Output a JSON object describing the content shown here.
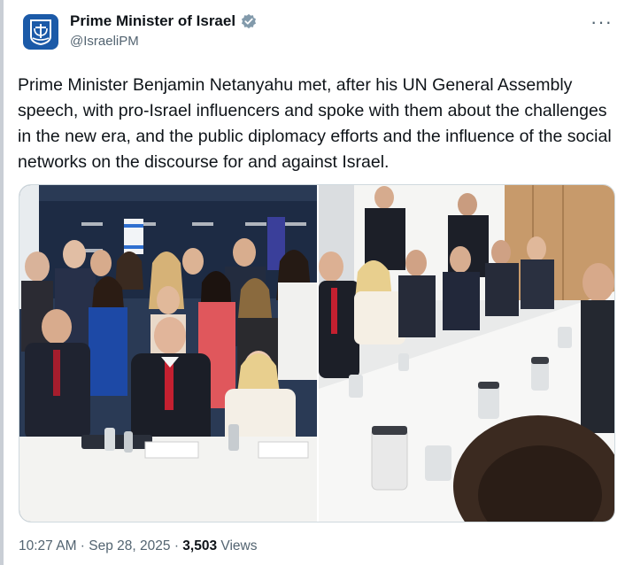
{
  "post": {
    "display_name": "Prime Minister of Israel",
    "handle": "@IsraeliPM",
    "more_label": "···",
    "text": "Prime Minister Benjamin Netanyahu met, after his UN General Assembly speech, with pro-Israel influencers and spoke with them about the challenges in the new era, and the public diplomacy efforts and the influence of the social networks on the discourse for and against Israel.",
    "time": "10:27 AM",
    "separator": " · ",
    "date": "Sep 28, 2025",
    "views_count": "3,503",
    "views_label": " Views"
  },
  "media": {
    "photos": [
      {
        "name": "group-photo"
      },
      {
        "name": "meeting-photo"
      }
    ]
  },
  "colors": {
    "text": "#0f1419",
    "muted": "#536471",
    "verified": "#829aab",
    "avatar_bg": "#1b5aa8"
  },
  "icons": [
    "israel-emblem-icon",
    "verified-badge-icon",
    "more-options-icon"
  ]
}
